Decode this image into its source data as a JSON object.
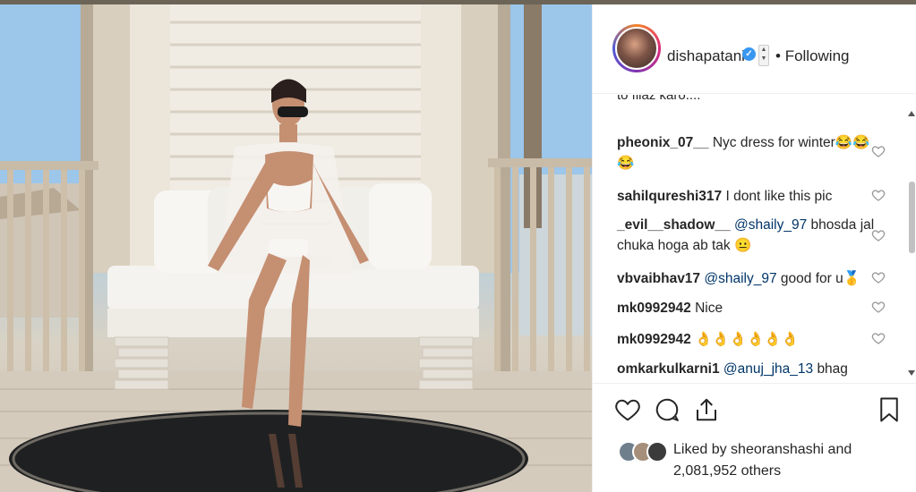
{
  "post": {
    "username": "dishapatani",
    "verified_mark": "✓",
    "sort_arrows": "▲▼",
    "separator": "•",
    "following_label": "Following"
  },
  "comments": {
    "partial_text": "to filaz karo....",
    "items": [
      {
        "user": "pheonix_07__",
        "text": "Nyc dress for winter😂😂",
        "text2": "😂"
      },
      {
        "user": "sahilqureshi317",
        "text": "I dont like this pic"
      },
      {
        "user": "_evil__shadow__",
        "mention": "@shaily_97",
        "text": "bhosda jal",
        "text2": "chuka hoga ab tak 😐"
      },
      {
        "user": "vbvaibhav17",
        "mention": "@shaily_97",
        "text": "good for u🥇"
      },
      {
        "user": "mk0992942",
        "text": "Nice"
      },
      {
        "user": "mk0992942",
        "text": "👌👌👌👌👌👌"
      },
      {
        "user": "omkarkulkarni1",
        "mention": "@anuj_jha_13",
        "text": "bhag"
      }
    ]
  },
  "actions": {
    "like_icon": "heart-icon",
    "comment_icon": "comment-icon",
    "share_icon": "share-icon",
    "save_icon": "bookmark-icon"
  },
  "likes": {
    "line1": "Liked by sheoranshashi and",
    "line2": "2,081,952 others"
  },
  "colors": {
    "link": "#003569",
    "verified": "#3897f0",
    "text": "#262626",
    "border": "#efefef"
  }
}
